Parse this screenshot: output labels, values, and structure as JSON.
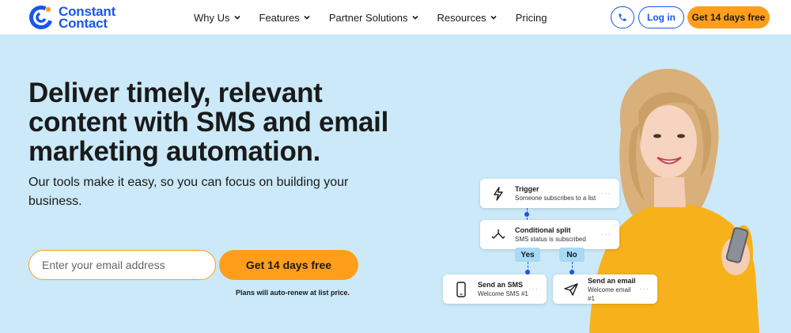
{
  "brand": {
    "name_line1": "Constant",
    "name_line2": "Contact",
    "color": "#1856ed",
    "accent": "#ff9e1b"
  },
  "nav": {
    "items": [
      {
        "label": "Why Us",
        "has_dropdown": true
      },
      {
        "label": "Features",
        "has_dropdown": true
      },
      {
        "label": "Partner Solutions",
        "has_dropdown": true
      },
      {
        "label": "Resources",
        "has_dropdown": true
      },
      {
        "label": "Pricing",
        "has_dropdown": false
      }
    ],
    "phone_icon": "phone-icon",
    "login_label": "Log in",
    "trial_label": "Get 14 days free"
  },
  "hero": {
    "title": "Deliver timely, relevant content with SMS and email marketing automation.",
    "subtitle": "Our tools make it easy, so you can focus on building your business.",
    "email_placeholder": "Enter your email address",
    "cta_label": "Get 14 days free",
    "renew_note": "Plans will auto-renew at list price."
  },
  "flow": {
    "trigger": {
      "title": "Trigger",
      "desc": "Someone subscribes to a list",
      "icon": "lightning-icon"
    },
    "split": {
      "title": "Conditional split",
      "desc": "SMS status is subscribed",
      "icon": "split-arrows-icon"
    },
    "yes_label": "Yes",
    "no_label": "No",
    "sms": {
      "title": "Send an SMS",
      "desc": "Welcome SMS #1",
      "icon": "mobile-phone-icon"
    },
    "email": {
      "title": "Send an email",
      "desc": "Welcome email #1",
      "icon": "paper-plane-icon"
    },
    "more": "···"
  }
}
